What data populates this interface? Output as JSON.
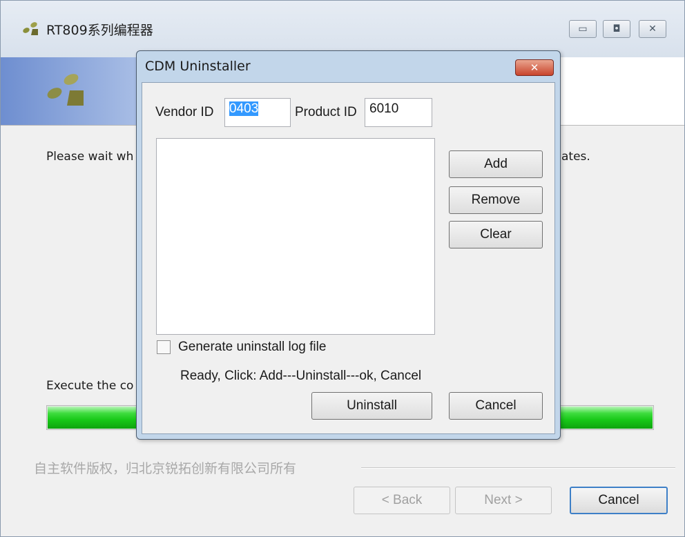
{
  "outer": {
    "title": "RT809系列编程器",
    "wait_text_left": "Please wait wh",
    "wait_text_right": "ates.",
    "execute_text": "Execute the co",
    "progress_fraction": 1.0,
    "copyright": "自主软件版权，归北京锐拓创新有限公司所有",
    "buttons": {
      "back": "< Back",
      "next": "Next >",
      "cancel": "Cancel"
    }
  },
  "dialog": {
    "title": "CDM Uninstaller",
    "close_glyph": "✕",
    "vendor_label": "Vendor ID",
    "vendor_value": "0403",
    "product_label": "Product ID",
    "product_value": "6010",
    "list_items": [],
    "buttons": {
      "add": "Add",
      "remove": "Remove",
      "clear": "Clear",
      "uninstall": "Uninstall",
      "cancel": "Cancel"
    },
    "checkbox_label": "Generate uninstall log file",
    "checkbox_checked": false,
    "status": "Ready, Click:  Add---Uninstall---ok,  Cancel"
  },
  "icons": {
    "app_logo": "app-logo-icon",
    "minimize": "minimize-icon",
    "maximize": "maximize-icon",
    "close": "close-icon"
  },
  "colors": {
    "progress": "#18c918",
    "dialog_frame": "#c2d6ea",
    "close_button": "#c8442c"
  }
}
